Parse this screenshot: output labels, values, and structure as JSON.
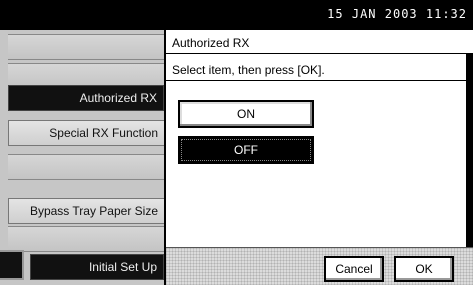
{
  "status_bar": {
    "datetime": "15  JAN   2003 11:32"
  },
  "left_panel": {
    "items": [
      {
        "label": ""
      },
      {
        "label": ""
      },
      {
        "label": "Authorized RX"
      },
      {
        "label": "Special RX Function"
      },
      {
        "label": ""
      },
      {
        "label": "Bypass Tray Paper Size"
      },
      {
        "label": ""
      },
      {
        "label": "Initial Set Up"
      }
    ]
  },
  "dialog": {
    "title": "Authorized RX",
    "instruction": "Select item, then press [OK].",
    "options": [
      {
        "label": "ON",
        "selected": false
      },
      {
        "label": "OFF",
        "selected": true
      }
    ],
    "cancel_label": "Cancel",
    "ok_label": "OK"
  }
}
